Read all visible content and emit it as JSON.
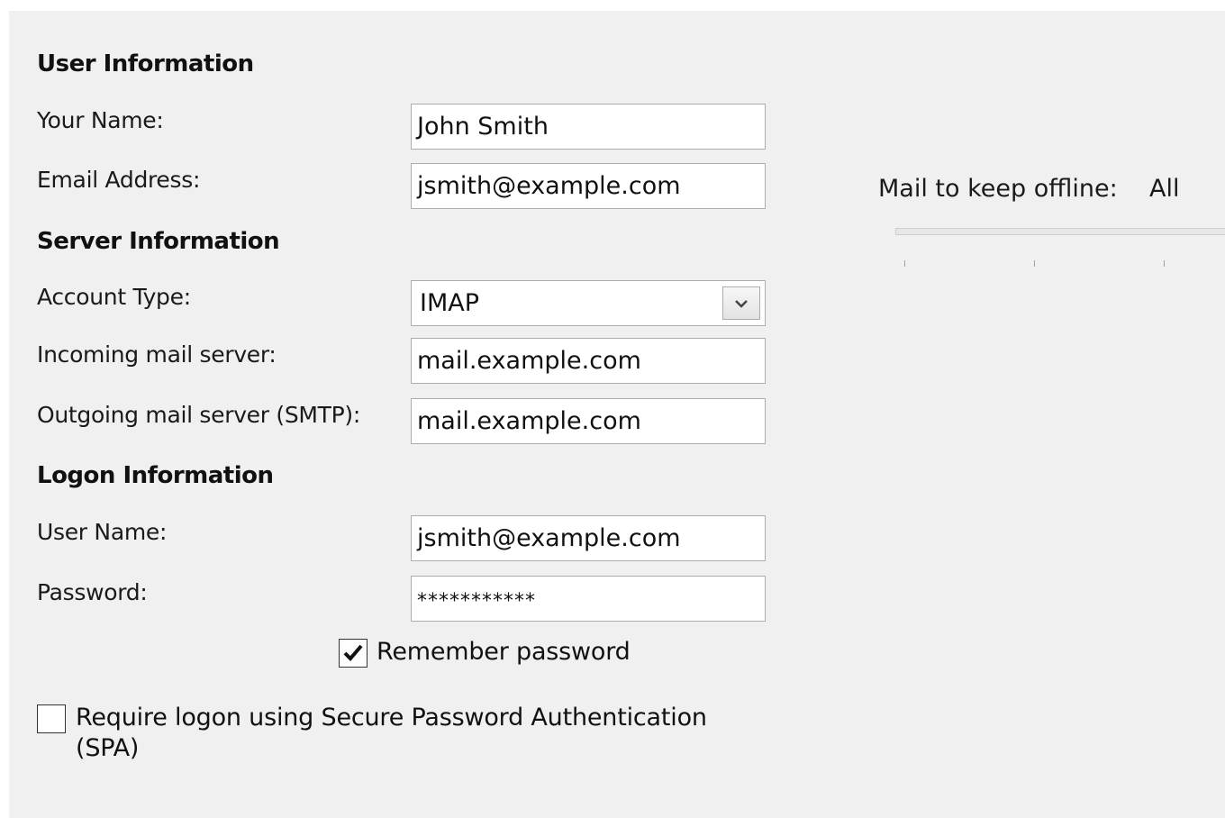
{
  "user_info": {
    "title": "User Information",
    "your_name_label": "Your Name:",
    "your_name_value": "John Smith",
    "email_label": "Email Address:",
    "email_value": "jsmith@example.com"
  },
  "server_info": {
    "title": "Server Information",
    "account_type_label": "Account Type:",
    "account_type_value": "IMAP",
    "incoming_label": "Incoming mail server:",
    "incoming_value": "mail.example.com",
    "outgoing_label": "Outgoing mail server (SMTP):",
    "outgoing_value": "mail.example.com"
  },
  "logon_info": {
    "title": "Logon Information",
    "username_label": "User Name:",
    "username_value": "jsmith@example.com",
    "password_label": "Password:",
    "password_value": "***********",
    "remember_label": "Remember password",
    "remember_checked": true,
    "spa_label": "Require logon using Secure Password Authentication (SPA)",
    "spa_checked": false
  },
  "offline": {
    "label": "Mail to keep offline:",
    "value": "All"
  },
  "icons": {
    "dropdown": "chevron-down-icon",
    "check": "checkmark-icon"
  },
  "colors": {
    "dialog_bg": "#f0f0f0",
    "field_border": "#adadad",
    "field_bg": "#ffffff"
  }
}
